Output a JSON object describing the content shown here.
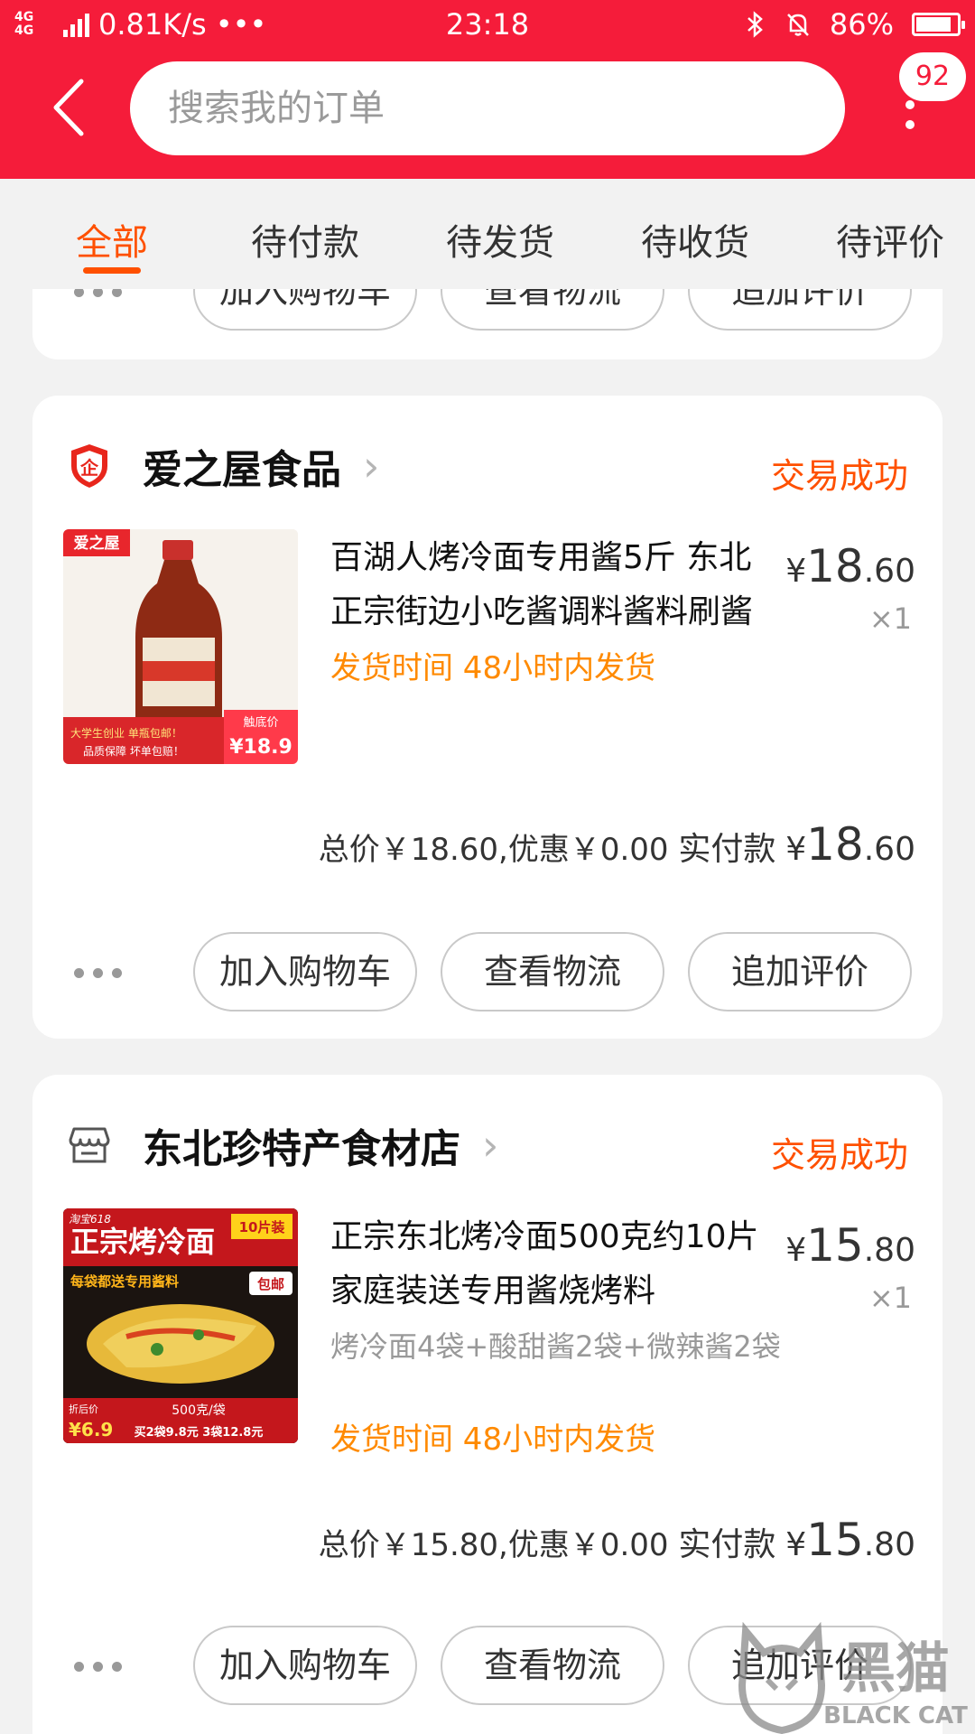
{
  "status_bar": {
    "network": "4G 4G",
    "speed": "0.81K/s",
    "dots": "•••",
    "time": "23:18",
    "battery_text": "86%",
    "battery_level": 0.86
  },
  "header": {
    "search_placeholder": "搜索我的订单",
    "badge_count": "92",
    "accent_color": "#f51c3a"
  },
  "tabs": [
    {
      "label": "全部",
      "active": true
    },
    {
      "label": "待付款",
      "active": false
    },
    {
      "label": "待发货",
      "active": false
    },
    {
      "label": "待收货",
      "active": false
    },
    {
      "label": "待评价",
      "active": false
    }
  ],
  "prev_card": {
    "buttons": [
      "加入购物车",
      "查看物流",
      "追加评价"
    ]
  },
  "orders": [
    {
      "shop_name": "爱之屋食品",
      "shop_icon": "enterprise-shield-icon",
      "status": "交易成功",
      "title": "百湖人烤冷面专用酱5斤 东北正宗街边小吃酱调料酱料刷酱",
      "shipping": "发货时间 48小时内发货",
      "price_symbol": "¥",
      "price_int": "18",
      "price_dec": ".60",
      "qty": "×1",
      "thumb": {
        "brand": "爱之屋",
        "price_tag_label": "触底价",
        "price_tag": "¥18.9",
        "slogan1": "大学生创业 单瓶包邮！",
        "slogan2": "品质保障 坏单包赔！"
      },
      "total_text": "总价￥18.60,优惠￥0.00",
      "paid_label": "实付款",
      "paid_symbol": "¥",
      "paid_int": "18",
      "paid_dec": ".60",
      "buttons": [
        "加入购物车",
        "查看物流",
        "追加评价"
      ]
    },
    {
      "shop_name": "东北珍特产食材店",
      "shop_icon": "store-icon",
      "status": "交易成功",
      "title": "正宗东北烤冷面500克约10片家庭装送专用酱烧烤料",
      "sku": "烤冷面4袋+酸甜酱2袋+微辣酱2袋",
      "shipping": "发货时间 48小时内发货",
      "price_symbol": "¥",
      "price_int": "15",
      "price_dec": ".80",
      "qty": "×1",
      "thumb": {
        "badge": "淘宝618",
        "headline": "正宗烤冷面",
        "tag": "10片装",
        "sub": "每袋都送专用酱料",
        "bao": "包邮",
        "price_label": "折后价",
        "price": "¥6.9",
        "weight": "500克/袋",
        "deal": "买2袋9.8元 3袋12.8元"
      },
      "total_text": "总价￥15.80,优惠￥0.00",
      "paid_label": "实付款",
      "paid_symbol": "¥",
      "paid_int": "15",
      "paid_dec": ".80",
      "buttons": [
        "加入购物车",
        "查看物流",
        "追加评价"
      ]
    }
  ],
  "watermark": {
    "text": "黑猫",
    "sub": "BLACK CAT"
  }
}
